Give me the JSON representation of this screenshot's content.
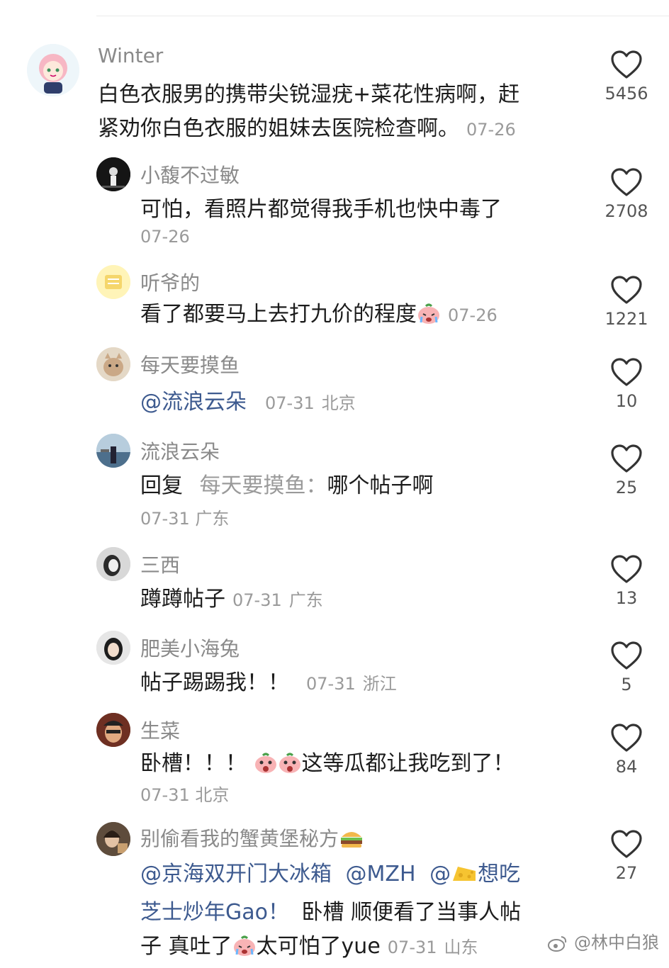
{
  "comments": [
    {
      "username": "Winter",
      "text_lines": [
        "白色衣服男的携带尖锐湿疣+菜花性病啊，赶",
        "紧劝你白色衣服的姐妹去医院检查啊。"
      ],
      "time": "07-26",
      "likes": "5456"
    },
    {
      "username": "小馥不过敏",
      "text": "可怕，看照片都觉得我手机也快中毒了",
      "time": "07-26",
      "likes": "2708"
    },
    {
      "username": "听爷的",
      "text": "看了都要马上去打九价的程度",
      "time": "07-26",
      "likes": "1221"
    },
    {
      "username": "每天要摸鱼",
      "mention": "@流浪云朵",
      "time": "07-31",
      "location": "北京",
      "likes": "10"
    },
    {
      "username": "流浪云朵",
      "reply_prefix": "回复",
      "reply_to": "每天要摸鱼：",
      "text": "哪个帖子啊",
      "time": "07-31",
      "location": "广东",
      "likes": "25"
    },
    {
      "username": "三西",
      "text": "蹲蹲帖子",
      "time": "07-31",
      "location": "广东",
      "likes": "13"
    },
    {
      "username": "肥美小海兔",
      "text": "帖子踢踢我！！",
      "time": "07-31",
      "location": "浙江",
      "likes": "5"
    },
    {
      "username": "生菜",
      "text_before": "卧槽！！！",
      "text_after": "这等瓜都让我吃到了！",
      "time": "07-31",
      "location": "北京",
      "likes": "84"
    },
    {
      "username": "别偷看我的蟹黄堡秘方",
      "mention_1": "@京海双开门大冰箱",
      "mention_2": "@MZH",
      "mention_3_prefix": "@",
      "mention_3_suffix": "想吃",
      "line2_mention": "芝士炒年Gao！",
      "line2_text": "卧槽 顺便看了当事人帖",
      "line3_text_a": "子 真吐了",
      "line3_text_b": "太可怕了yue",
      "time": "07-31",
      "location": "山东",
      "likes": "27"
    }
  ],
  "watermark": "@林中白狼",
  "colors": {
    "mention": "#3d5a8f",
    "muted": "#9a9a9a",
    "text": "#1c1c1c"
  },
  "icons": [
    "heart-outline-icon",
    "crying-face-emoji",
    "shocked-face-emoji",
    "burger-emoji",
    "cheese-emoji",
    "weibo-logo-icon"
  ]
}
